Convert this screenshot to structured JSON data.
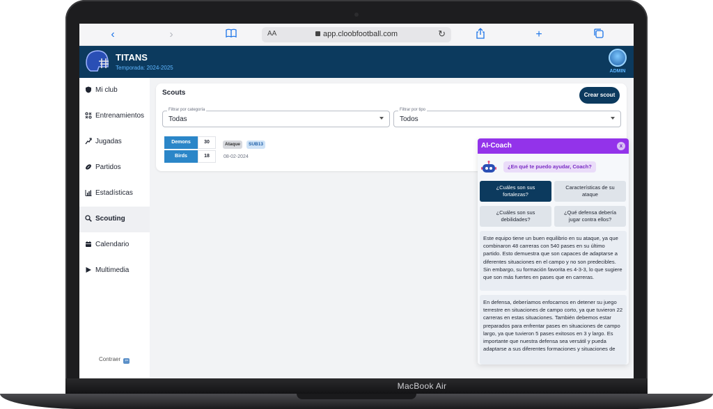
{
  "device": {
    "brand": "MacBook Air"
  },
  "browser": {
    "aa_label": "AA",
    "url": "app.cloobfootball.com"
  },
  "team": {
    "name": "TITANS",
    "season": "Temporada: 2024-2025",
    "role": "ADMIN"
  },
  "sidebar": {
    "items": [
      {
        "label": "Mi club",
        "icon": "shield-icon"
      },
      {
        "label": "Entrenamientos",
        "icon": "drills-icon"
      },
      {
        "label": "Jugadas",
        "icon": "playbook-icon"
      },
      {
        "label": "Partidos",
        "icon": "football-icon"
      },
      {
        "label": "Estadísticas",
        "icon": "bar-chart-icon"
      },
      {
        "label": "Scouting",
        "icon": "search-icon"
      },
      {
        "label": "Calendario",
        "icon": "calendar-icon"
      },
      {
        "label": "Multimedia",
        "icon": "play-icon"
      }
    ],
    "active": "Scouting",
    "collapse_label": "Contraer"
  },
  "scouts": {
    "title": "Scouts",
    "create_button": "Crear scout",
    "filter_category": {
      "label": "Filtrar por categoría",
      "value": "Todas"
    },
    "filter_type": {
      "label": "Filtrar por tipo",
      "value": "Todos"
    },
    "match": {
      "home": {
        "name": "Demons",
        "score": "30"
      },
      "away": {
        "name": "Birds",
        "score": "18"
      },
      "tags": [
        "Ataque",
        "SUB13"
      ],
      "date": "08-02-2024"
    }
  },
  "ai_coach": {
    "title": "AI-Coach",
    "close": "x",
    "greeting": "¿En qué te puedo ayudar, Coach?",
    "questions": [
      "¿Cuáles son sus fortalezas?",
      "Características de su ataque",
      "¿Cuáles son sus debilidades?",
      "¿Qué defensa debería jugar contra ellos?"
    ],
    "selected_question": "¿Cuáles son sus fortalezas?",
    "responses": [
      "Este equipo tiene un buen equilibrio en su ataque, ya que combinaron 48 carreras con 540 pases en su último partido. Esto demuestra que son capaces de adaptarse a diferentes situaciones en el campo y no son predecibles. Sin embargo, su formación favorita es 4-3-3, lo que sugiere que son más fuertes en pases que en carreras.",
      "En defensa, deberíamos enfocarnos en detener su juego terrestre en situaciones de campo corto, ya que tuvieron 22 carreras en estas situaciones. También debemos estar preparados para enfrentar pases en situaciones de campo largo, ya que tuvieron 5 pases exitosos en 3 y largo. Es importante que nuestra defensa sea versátil y pueda adaptarse a sus diferentes formaciones y situaciones de"
    ]
  },
  "colors": {
    "navy": "#0c3a5e",
    "purple": "#9333ea",
    "blue": "#2b86c8"
  }
}
